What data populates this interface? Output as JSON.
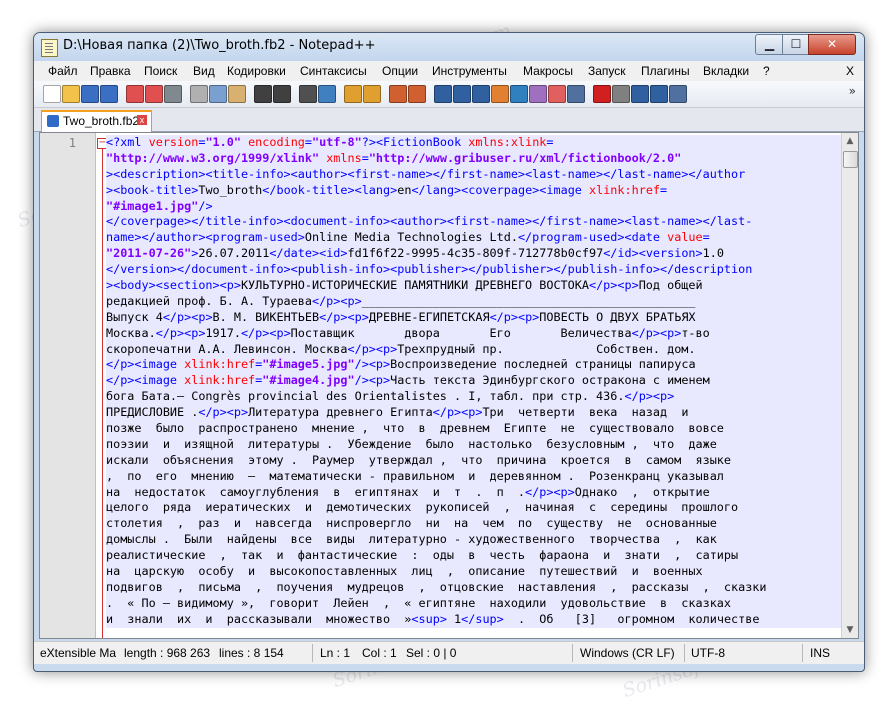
{
  "window": {
    "title": "D:\\Новая папка (2)\\Two_broth.fb2 - Notepad++"
  },
  "menu": [
    "Файл",
    "Правка",
    "Поиск",
    "Вид",
    "Кодировки",
    "Синтаксисы",
    "Опции",
    "Инструменты",
    "Макросы",
    "Запуск",
    "Плагины",
    "Вкладки",
    "?"
  ],
  "menu_close": "X",
  "toolbar": {
    "icons": [
      "new-file-icon",
      "open-file-icon",
      "save-icon",
      "save-all-icon",
      "close-icon",
      "close-all-icon",
      "print-icon",
      "cut-icon",
      "copy-icon",
      "paste-icon",
      "undo-icon",
      "redo-icon",
      "find-icon",
      "replace-icon",
      "zoom-in-icon",
      "zoom-out-icon",
      "sync-v-icon",
      "sync-h-icon",
      "word-wrap-icon",
      "show-all-chars-icon",
      "indent-guide-icon",
      "user-lang-icon",
      "doc-map-icon",
      "function-list-icon",
      "folder-icon",
      "monitor-icon",
      "record-icon",
      "stop-icon",
      "play-icon",
      "play-multi-icon",
      "save-macro-icon"
    ],
    "more": "»"
  },
  "tab": {
    "label": "Two_broth.fb2",
    "close": "x"
  },
  "editor": {
    "line_number": "1",
    "fold": "−",
    "lines": [
      [
        [
          "tag",
          "<?xml "
        ],
        [
          "attr",
          "version"
        ],
        [
          "tag",
          "="
        ],
        [
          "val",
          "\"1.0\""
        ],
        [
          "tag",
          " "
        ],
        [
          "attr",
          "encoding"
        ],
        [
          "tag",
          "="
        ],
        [
          "val",
          "\"utf-8\""
        ],
        [
          "tag",
          "?><FictionBook "
        ],
        [
          "attr",
          "xmlns:xlink"
        ],
        [
          "tag",
          "="
        ]
      ],
      [
        [
          "val",
          "\"http://www.w3.org/1999/xlink\""
        ],
        [
          "tag",
          " "
        ],
        [
          "attr",
          "xmlns"
        ],
        [
          "tag",
          "="
        ],
        [
          "val",
          "\"http://www.gribuser.ru/xml/fictionbook/2.0\""
        ]
      ],
      [
        [
          "tag",
          "><description><title-info><author><first-name></first-name><last-name></last-name></author"
        ]
      ],
      [
        [
          "tag",
          "><book-title>"
        ],
        [
          "txt",
          "Two_broth"
        ],
        [
          "tag",
          "</book-title><lang>"
        ],
        [
          "txt",
          "en"
        ],
        [
          "tag",
          "</lang><coverpage><image "
        ],
        [
          "attr",
          "xlink:href"
        ],
        [
          "tag",
          "="
        ]
      ],
      [
        [
          "val",
          "\"#image1.jpg\""
        ],
        [
          "tag",
          "/>"
        ]
      ],
      [
        [
          "tag",
          "</coverpage></title-info><document-info><author><first-name></first-name><last-name></last-"
        ]
      ],
      [
        [
          "tag",
          "name></author><program-used>"
        ],
        [
          "txt",
          "Online Media Technologies Ltd."
        ],
        [
          "tag",
          "</program-used><date "
        ],
        [
          "attr",
          "value"
        ],
        [
          "tag",
          "="
        ]
      ],
      [
        [
          "val",
          "\"2011-07-26\""
        ],
        [
          "tag",
          ">"
        ],
        [
          "txt",
          "26.07.2011"
        ],
        [
          "tag",
          "</date><id>"
        ],
        [
          "txt",
          "fd1f6f22-9995-4c35-809f-712778b0cf97"
        ],
        [
          "tag",
          "</id><version>"
        ],
        [
          "txt",
          "1.0"
        ]
      ],
      [
        [
          "tag",
          "</version></document-info><publish-info><publisher></publisher></publish-info></description"
        ]
      ],
      [
        [
          "tag",
          "><body><section><p>"
        ],
        [
          "txt",
          "КУЛЬТУРНО-ИСТОРИЧЕСКИЕ ПАМЯТНИКИ ДРЕВНЕГО ВОСТОКА"
        ],
        [
          "tag",
          "</p><p>"
        ],
        [
          "txt",
          "Под общей"
        ]
      ],
      [
        [
          "txt",
          "редакцией проф. Б. А. Тураева"
        ],
        [
          "tag",
          "</p><p>"
        ],
        [
          "txt",
          "_______________________________________________"
        ]
      ],
      [
        [
          "txt",
          "Выпуск 4"
        ],
        [
          "tag",
          "</p><p>"
        ],
        [
          "txt",
          "В. М. ВИКЕНТЬЕВ"
        ],
        [
          "tag",
          "</p><p>"
        ],
        [
          "txt",
          "ДРЕВНЕ-ЕГИПЕТСКАЯ"
        ],
        [
          "tag",
          "</p><p>"
        ],
        [
          "txt",
          "ПОВЕСТЬ О ДВУХ БРАТЬЯХ"
        ]
      ],
      [
        [
          "txt",
          "Москва."
        ],
        [
          "tag",
          "</p><p>"
        ],
        [
          "txt",
          "1917."
        ],
        [
          "tag",
          "</p><p>"
        ],
        [
          "txt",
          "Поставщик       двора       Его       Величества"
        ],
        [
          "tag",
          "</p><p>"
        ],
        [
          "txt",
          "т-во"
        ]
      ],
      [
        [
          "txt",
          "скоропечатни А.А. Левинсон. Москва"
        ],
        [
          "tag",
          "</p><p>"
        ],
        [
          "txt",
          "Трехпрудный пр.             Собствен. дом."
        ]
      ],
      [
        [
          "tag",
          "</p><image "
        ],
        [
          "attr",
          "xlink:href"
        ],
        [
          "tag",
          "="
        ],
        [
          "val",
          "\"#image5.jpg\""
        ],
        [
          "tag",
          "/><p>"
        ],
        [
          "txt",
          "Воспроизведение последней страницы папируса"
        ]
      ],
      [
        [
          "tag",
          "</p><image "
        ],
        [
          "attr",
          "xlink:href"
        ],
        [
          "tag",
          "="
        ],
        [
          "val",
          "\"#image4.jpg\""
        ],
        [
          "tag",
          "/><p>"
        ],
        [
          "txt",
          "Часть текста Эдинбургского остракона с именем"
        ]
      ],
      [
        [
          "txt",
          "бога Бата.— Congrès provincial des Orientalistes . I, табл. при стр. 436."
        ],
        [
          "tag",
          "</p><p>"
        ]
      ],
      [
        [
          "txt",
          "ПРЕДИСЛОВИЕ ."
        ],
        [
          "tag",
          "</p><p>"
        ],
        [
          "txt",
          "Литература древнего Египта"
        ],
        [
          "tag",
          "</p><p>"
        ],
        [
          "txt",
          "Три  четверти  века  назад  и"
        ]
      ],
      [
        [
          "txt",
          "позже  было  распространено  мнение ,  что  в  древнем  Египте  не  существовало  вовсе"
        ]
      ],
      [
        [
          "txt",
          "поэзии  и  изящной  литературы .  Убеждение  было  настолько  безусловным ,  что  даже"
        ]
      ],
      [
        [
          "txt",
          "искали  объяснения  этому .  Раумер  утверждал ,  что  причина  кроется  в  самом  языке"
        ]
      ],
      [
        [
          "txt",
          ",  по  его  мнению  —  математически - правильном  и  деревянном .  Розенкранц указывал"
        ]
      ],
      [
        [
          "txt",
          "на  недостаток  самоуглубления  в  египтянах  и  т  .  п  ."
        ],
        [
          "tag",
          "</p><p>"
        ],
        [
          "txt",
          "Однако  ,  открытие"
        ]
      ],
      [
        [
          "txt",
          "целого  ряда  иератических  и  демотических  рукописей  ,  начиная  с  середины  прошлого"
        ]
      ],
      [
        [
          "txt",
          "столетия  ,  раз  и  навсегда  ниспровергло  ни  на  чем  по  существу  не  основанные"
        ]
      ],
      [
        [
          "txt",
          "домыслы .  Были  найдены  все  виды  литературно - художественного  творчества  ,  как"
        ]
      ],
      [
        [
          "txt",
          "реалистические  ,  так  и  фантастические  :  оды  в  честь  фараона  и  знати  ,  сатиры"
        ]
      ],
      [
        [
          "txt",
          "на  царскую  особу  и  высокопоставленных  лиц  ,  описание  путешествий  и  военных"
        ]
      ],
      [
        [
          "txt",
          "подвигов  ,  письма  ,  поучения  мудрецов  ,  отцовские  наставления  ,  рассказы  ,  сказки"
        ]
      ],
      [
        [
          "txt",
          ".  « По – видимому »,  говорит  Лейен  ,  « египтяне  находили  удовольствие  в  сказках"
        ]
      ],
      [
        [
          "txt",
          "и  знали  их  и  рассказывали  множество  »"
        ],
        [
          "tag",
          "<sup>"
        ],
        [
          "txt",
          " 1"
        ],
        [
          "tag",
          "</sup>"
        ],
        [
          "txt",
          "  .  Об   [3]   огромном  количестве"
        ]
      ]
    ]
  },
  "status": {
    "type": "eXtensible Ma",
    "length": "length : 968 263",
    "lines": "lines : 8 154",
    "ln": "Ln : 1",
    "col": "Col : 1",
    "sel": "Sel : 0 | 0",
    "eol": "Windows (CR LF)",
    "encoding": "UTF-8",
    "mode": "INS"
  },
  "watermark": "Sorinsoft.com",
  "colors": {
    "tag": "#0000ff",
    "attr": "#ff0000",
    "value": "#8000ff",
    "text": "#000000",
    "line_highlight": "#e8e8ff",
    "tab_accent": "#f7a020"
  }
}
